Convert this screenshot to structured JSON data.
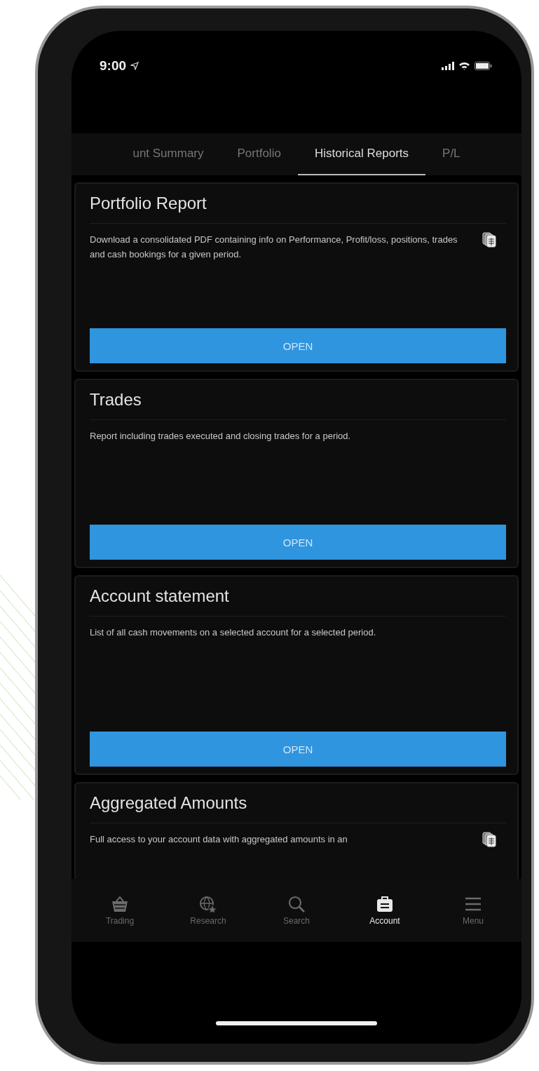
{
  "status_bar": {
    "time": "9:00",
    "location_arrow": true
  },
  "tabs": [
    {
      "label": "unt Summary",
      "selected": false
    },
    {
      "label": "Portfolio",
      "selected": false
    },
    {
      "label": "Historical Reports",
      "selected": true
    },
    {
      "label": "P/L",
      "selected": false
    }
  ],
  "cards": [
    {
      "title": "Portfolio Report",
      "description": "Download a consolidated PDF containing info on Performance, Profit/loss, positions, trades and cash bookings for a given period.",
      "document_icon": true,
      "button": "OPEN"
    },
    {
      "title": "Trades",
      "description": "Report including trades executed and closing trades for a period.",
      "document_icon": false,
      "button": "OPEN"
    },
    {
      "title": "Account statement",
      "description": "List of all cash movements on a selected account for a selected period.",
      "document_icon": false,
      "button": "OPEN"
    },
    {
      "title": "Aggregated Amounts",
      "description": "Full access to your account data with aggregated amounts in an",
      "document_icon": true
    }
  ],
  "nav": [
    {
      "kind": "basket",
      "label": "Trading",
      "selected": false
    },
    {
      "kind": "globe",
      "label": "Research",
      "selected": false
    },
    {
      "kind": "search",
      "label": "Search",
      "selected": false
    },
    {
      "kind": "briefcase",
      "label": "Account",
      "selected": true
    },
    {
      "kind": "menu",
      "label": "Menu",
      "selected": false
    }
  ]
}
